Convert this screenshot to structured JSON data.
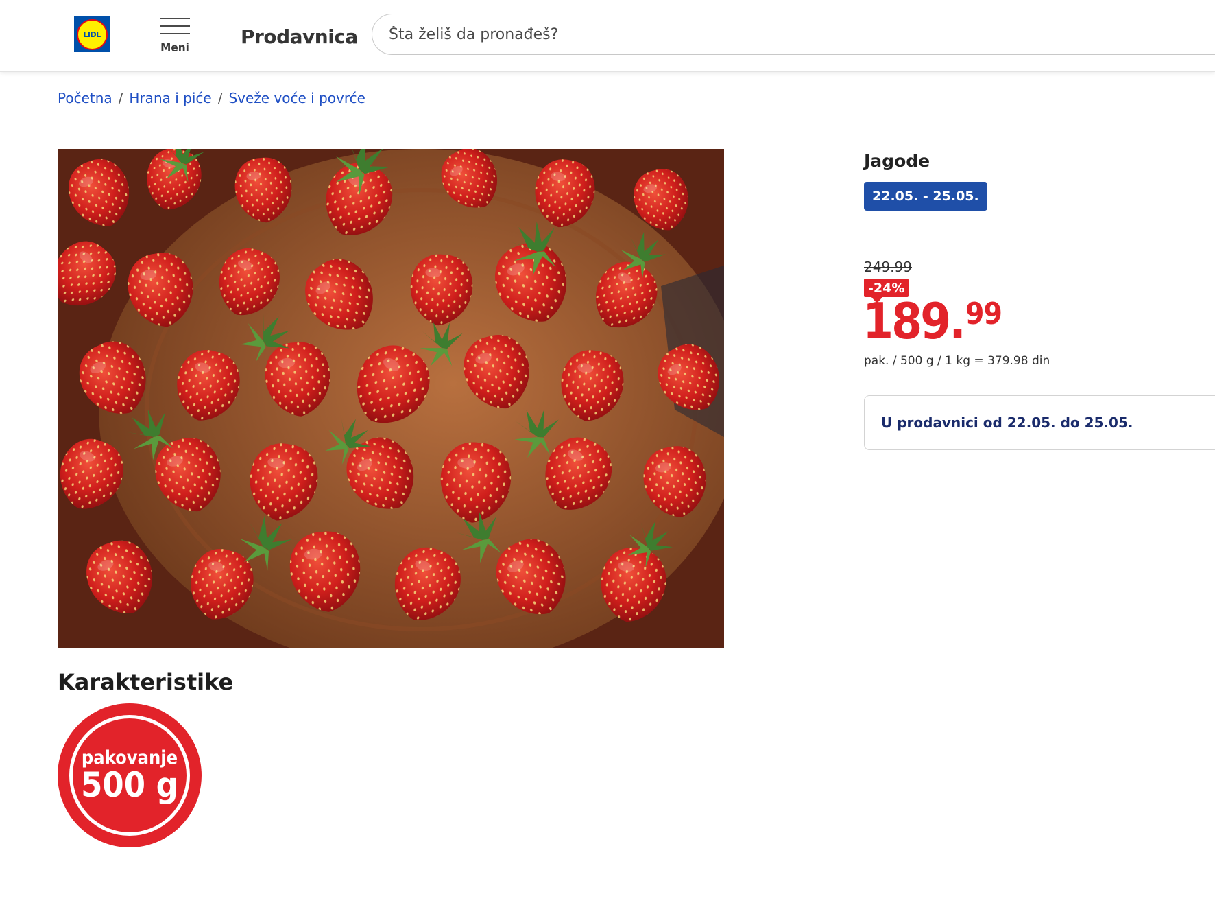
{
  "header": {
    "logo_text": "LIDL",
    "menu_label": "Meni",
    "shop_title": "Prodavnica",
    "search_placeholder": "Šta želiš da pronađeš?"
  },
  "breadcrumb": {
    "items": [
      "Početna",
      "Hrana i piće",
      "Sveže voće i povrće"
    ],
    "separator": "/"
  },
  "product": {
    "name": "Jagode",
    "date_range": "22.05. - 25.05.",
    "old_price": "249.99",
    "discount": "-24%",
    "price_main": "189.",
    "price_cents": "99",
    "unit_info": "pak. / 500 g / 1 kg = 379.98 din",
    "availability": "U prodavnici od 22.05. do 25.05.",
    "image_subject": "strawberries"
  },
  "characteristics": {
    "title": "Karakteristike",
    "badge_top": "pakovanje",
    "badge_bottom": "500 g"
  },
  "colors": {
    "brand_blue": "#0050aa",
    "brand_yellow": "#fff000",
    "price_red": "#e2232a",
    "link_blue": "#1f4fc4",
    "date_pill_blue": "#1f4fa8",
    "availability_text": "#1a2b6b"
  },
  "icons": [
    "lidl-logo",
    "hamburger-menu-icon"
  ]
}
